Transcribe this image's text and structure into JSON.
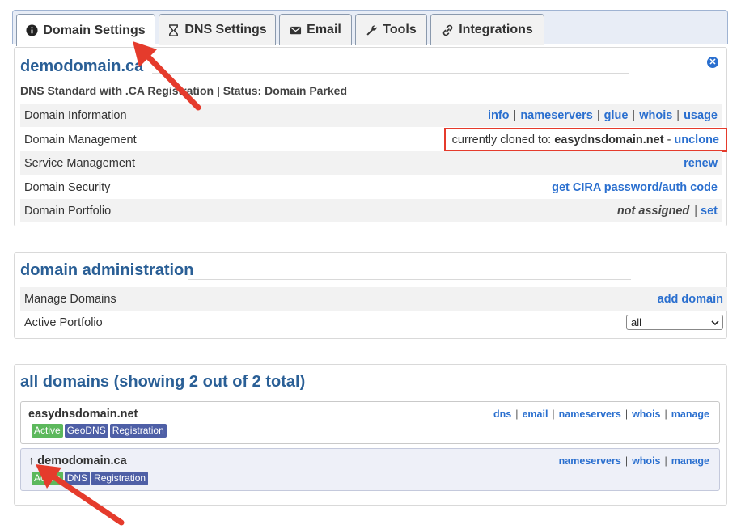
{
  "tabs": [
    {
      "label": "Domain Settings",
      "icon": "info-circle-icon",
      "active": true
    },
    {
      "label": "DNS Settings",
      "icon": "hourglass-icon",
      "active": false
    },
    {
      "label": "Email",
      "icon": "envelope-icon",
      "active": false
    },
    {
      "label": "Tools",
      "icon": "wrench-icon",
      "active": false
    },
    {
      "label": "Integrations",
      "icon": "link-icon",
      "active": false
    }
  ],
  "domain_panel": {
    "title": "demodomain.ca",
    "subtitle": "DNS Standard with .CA Registration | Status: Domain Parked",
    "rows": [
      {
        "label": "Domain Information",
        "links": [
          "info",
          "nameservers",
          "glue",
          "whois",
          "usage"
        ]
      },
      {
        "label": "Domain Management",
        "prefix": "currently cloned to:",
        "value": "easydnsdomain.net",
        "dash": "-",
        "link": "unclone"
      },
      {
        "label": "Service Management",
        "link": "renew"
      },
      {
        "label": "Domain Security",
        "link": "get CIRA password/auth code"
      },
      {
        "label": "Domain Portfolio",
        "status": "not assigned",
        "link": "set"
      }
    ]
  },
  "admin_panel": {
    "title": "domain administration",
    "rows": [
      {
        "label": "Manage Domains",
        "link": "add domain"
      },
      {
        "label": "Active Portfolio",
        "select_value": "all"
      }
    ]
  },
  "all_domains": {
    "title": "all domains (showing 2 out of 2 total)",
    "domains": [
      {
        "name": "easydnsdomain.net",
        "links": [
          "dns",
          "email",
          "nameservers",
          "whois",
          "manage"
        ],
        "badges": [
          "Active",
          "GeoDNS",
          "Registration"
        ]
      },
      {
        "prefix": "↑",
        "name": "demodomain.ca",
        "links": [
          "nameservers",
          "whois",
          "manage"
        ],
        "badges": [
          "Active",
          "DNS",
          "Registration"
        ]
      }
    ]
  },
  "colors": {
    "link": "#2a6fcf",
    "title": "#2a5f96",
    "annotation": "#e53b2c",
    "badge_active": "#5cb85c",
    "badge_other": "#4e5fa6"
  }
}
